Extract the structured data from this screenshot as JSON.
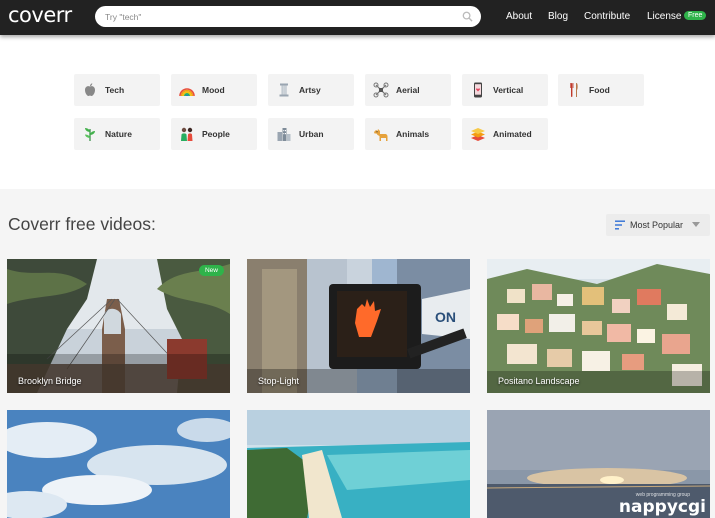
{
  "header": {
    "logo": "coverr",
    "search_placeholder": "Try \"tech\"",
    "nav": [
      "About",
      "Blog",
      "Contribute",
      "License"
    ],
    "license_badge": "Free"
  },
  "categories": [
    {
      "label": "Tech",
      "icon": "apple-icon"
    },
    {
      "label": "Mood",
      "icon": "rainbow-icon"
    },
    {
      "label": "Artsy",
      "icon": "statue-icon"
    },
    {
      "label": "Aerial",
      "icon": "drone-icon"
    },
    {
      "label": "Vertical",
      "icon": "phone-icon"
    },
    {
      "label": "Food",
      "icon": "utensils-icon"
    },
    {
      "label": "Nature",
      "icon": "plant-icon"
    },
    {
      "label": "People",
      "icon": "people-icon"
    },
    {
      "label": "Urban",
      "icon": "buildings-icon"
    },
    {
      "label": "Animals",
      "icon": "dog-icon"
    },
    {
      "label": "Animated",
      "icon": "layers-icon"
    }
  ],
  "videos_section": {
    "title": "Coverr free videos:",
    "sort_label": "Most Popular"
  },
  "videos": [
    {
      "title": "Brooklyn Bridge",
      "badge": "New"
    },
    {
      "title": "Stop-Light",
      "badge": ""
    },
    {
      "title": "Positano Landscape",
      "badge": ""
    },
    {
      "title": "",
      "badge": ""
    },
    {
      "title": "",
      "badge": ""
    },
    {
      "title": "",
      "badge": ""
    }
  ],
  "watermark": {
    "main": "nappycgi",
    "small": "web programming group"
  },
  "colors": {
    "header_bg": "#222222",
    "badge_green": "#2fb34a",
    "section_bg": "#f5f5f5"
  }
}
